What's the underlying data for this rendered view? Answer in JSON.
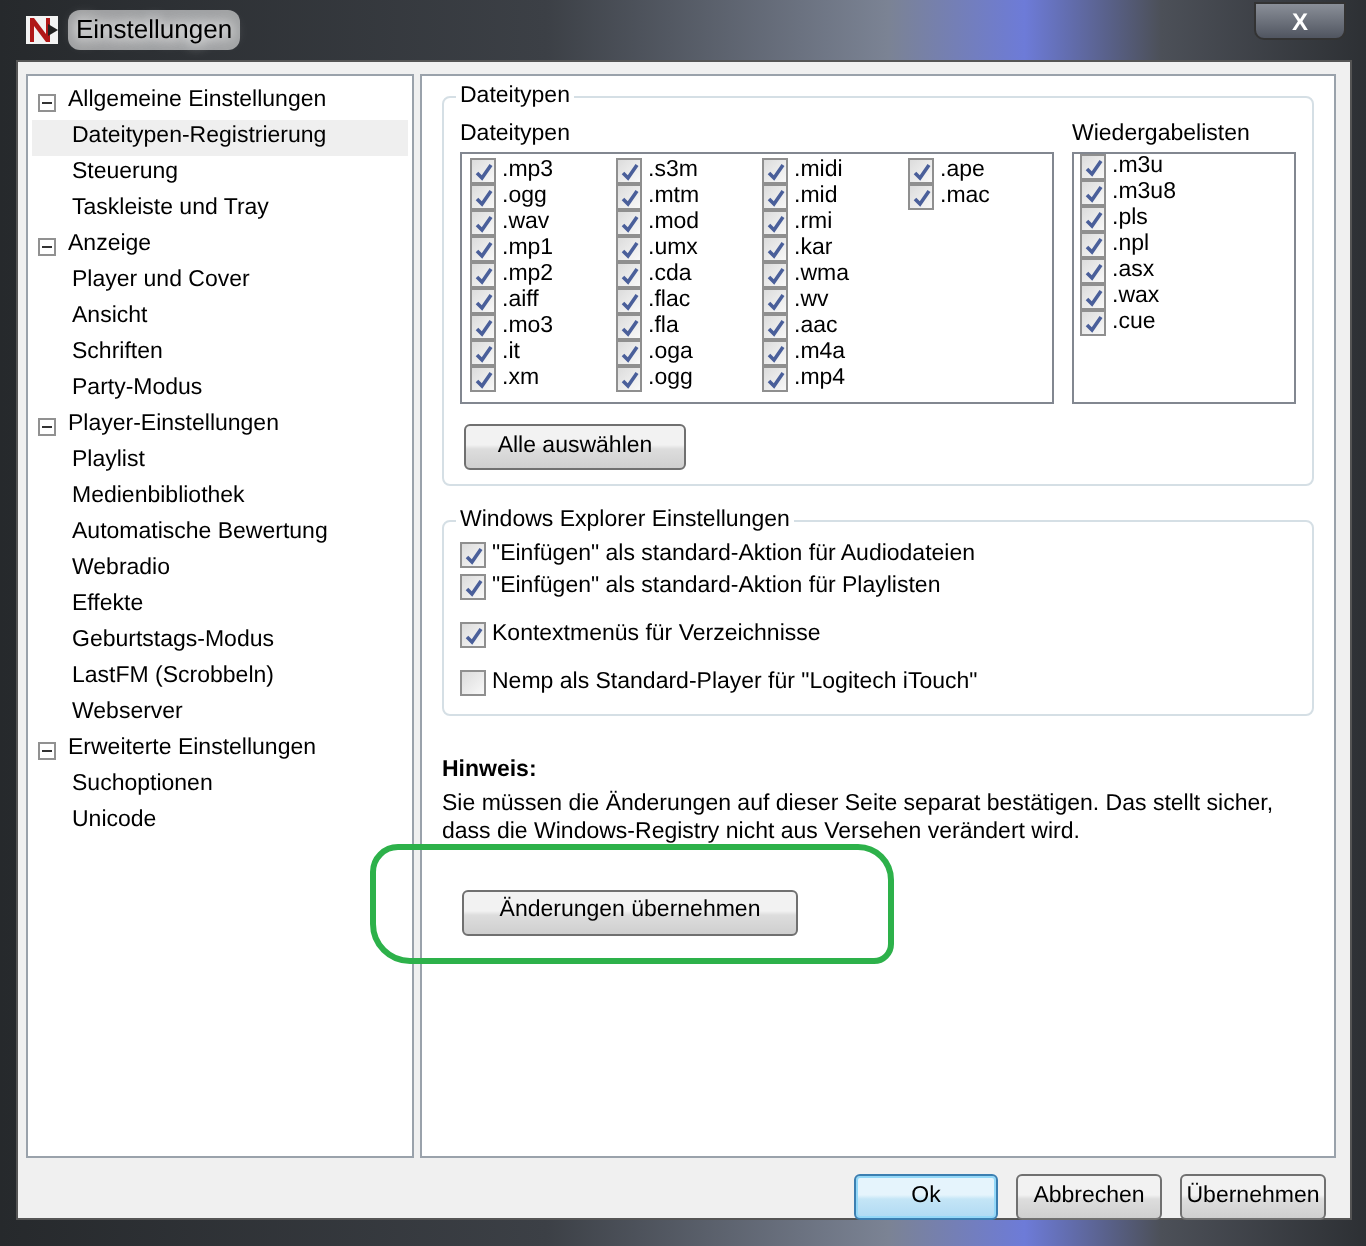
{
  "window": {
    "title": "Einstellungen",
    "close_label": "X"
  },
  "tree": [
    {
      "label": "Allgemeine Einstellungen",
      "expanded": true,
      "selected": false,
      "children": [
        {
          "label": "Dateitypen-Registrierung",
          "selected": true
        },
        {
          "label": "Steuerung",
          "selected": false
        },
        {
          "label": "Taskleiste und Tray",
          "selected": false
        }
      ]
    },
    {
      "label": "Anzeige",
      "expanded": true,
      "selected": false,
      "children": [
        {
          "label": "Player und Cover",
          "selected": false
        },
        {
          "label": "Ansicht",
          "selected": false
        },
        {
          "label": "Schriften",
          "selected": false
        },
        {
          "label": "Party-Modus",
          "selected": false
        }
      ]
    },
    {
      "label": "Player-Einstellungen",
      "expanded": true,
      "selected": false,
      "children": [
        {
          "label": "Playlist",
          "selected": false
        },
        {
          "label": "Medienbibliothek",
          "selected": false
        },
        {
          "label": "Automatische Bewertung",
          "selected": false
        },
        {
          "label": "Webradio",
          "selected": false
        },
        {
          "label": "Effekte",
          "selected": false
        },
        {
          "label": "Geburtstags-Modus",
          "selected": false
        },
        {
          "label": "LastFM (Scrobbeln)",
          "selected": false
        },
        {
          "label": "Webserver",
          "selected": false
        }
      ]
    },
    {
      "label": "Erweiterte Einstellungen",
      "expanded": true,
      "selected": false,
      "children": [
        {
          "label": "Suchoptionen",
          "selected": false
        },
        {
          "label": "Unicode",
          "selected": false
        }
      ]
    }
  ],
  "filetypes_group": {
    "title": "Dateitypen",
    "list_label": "Dateitypen",
    "columns": [
      [
        {
          "label": ".mp3",
          "checked": true
        },
        {
          "label": ".ogg",
          "checked": true
        },
        {
          "label": ".wav",
          "checked": true
        },
        {
          "label": ".mp1",
          "checked": true
        },
        {
          "label": ".mp2",
          "checked": true
        },
        {
          "label": ".aiff",
          "checked": true
        },
        {
          "label": ".mo3",
          "checked": true
        },
        {
          "label": ".it",
          "checked": true
        },
        {
          "label": ".xm",
          "checked": true
        }
      ],
      [
        {
          "label": ".s3m",
          "checked": true
        },
        {
          "label": ".mtm",
          "checked": true
        },
        {
          "label": ".mod",
          "checked": true
        },
        {
          "label": ".umx",
          "checked": true
        },
        {
          "label": ".cda",
          "checked": true
        },
        {
          "label": ".flac",
          "checked": true
        },
        {
          "label": ".fla",
          "checked": true
        },
        {
          "label": ".oga",
          "checked": true
        },
        {
          "label": ".ogg",
          "checked": true
        }
      ],
      [
        {
          "label": ".midi",
          "checked": true
        },
        {
          "label": ".mid",
          "checked": true
        },
        {
          "label": ".rmi",
          "checked": true
        },
        {
          "label": ".kar",
          "checked": true
        },
        {
          "label": ".wma",
          "checked": true
        },
        {
          "label": ".wv",
          "checked": true
        },
        {
          "label": ".aac",
          "checked": true
        },
        {
          "label": ".m4a",
          "checked": true
        },
        {
          "label": ".mp4",
          "checked": true
        }
      ],
      [
        {
          "label": ".ape",
          "checked": true
        },
        {
          "label": ".mac",
          "checked": true
        }
      ]
    ],
    "playlist_label": "Wiedergabelisten",
    "playlists": [
      {
        "label": ".m3u",
        "checked": true
      },
      {
        "label": ".m3u8",
        "checked": true
      },
      {
        "label": ".pls",
        "checked": true
      },
      {
        "label": ".npl",
        "checked": true
      },
      {
        "label": ".asx",
        "checked": true
      },
      {
        "label": ".wax",
        "checked": true
      },
      {
        "label": ".cue",
        "checked": true
      }
    ],
    "select_all_button": "Alle auswählen"
  },
  "explorer_group": {
    "title": "Windows Explorer Einstellungen",
    "options": [
      {
        "label": "\"Einfügen\" als standard-Aktion für Audiodateien",
        "checked": true
      },
      {
        "label": "\"Einfügen\" als standard-Aktion für Playlisten",
        "checked": true
      },
      {
        "label": "Kontextmenüs für Verzeichnisse",
        "checked": true
      },
      {
        "label": "Nemp als Standard-Player für \"Logitech iTouch\"",
        "checked": false
      }
    ]
  },
  "note": {
    "heading": "Hinweis:",
    "text": "Sie müssen die Änderungen auf dieser Seite separat bestätigen. Das stellt sicher, dass die Windows-Registry nicht aus Versehen verändert wird."
  },
  "apply_changes_button": "Änderungen übernehmen",
  "footer_buttons": [
    {
      "label": "Ok",
      "kind": "default"
    },
    {
      "label": "Abbrechen",
      "kind": "normal"
    },
    {
      "label": "Übernehmen",
      "kind": "normal"
    }
  ]
}
